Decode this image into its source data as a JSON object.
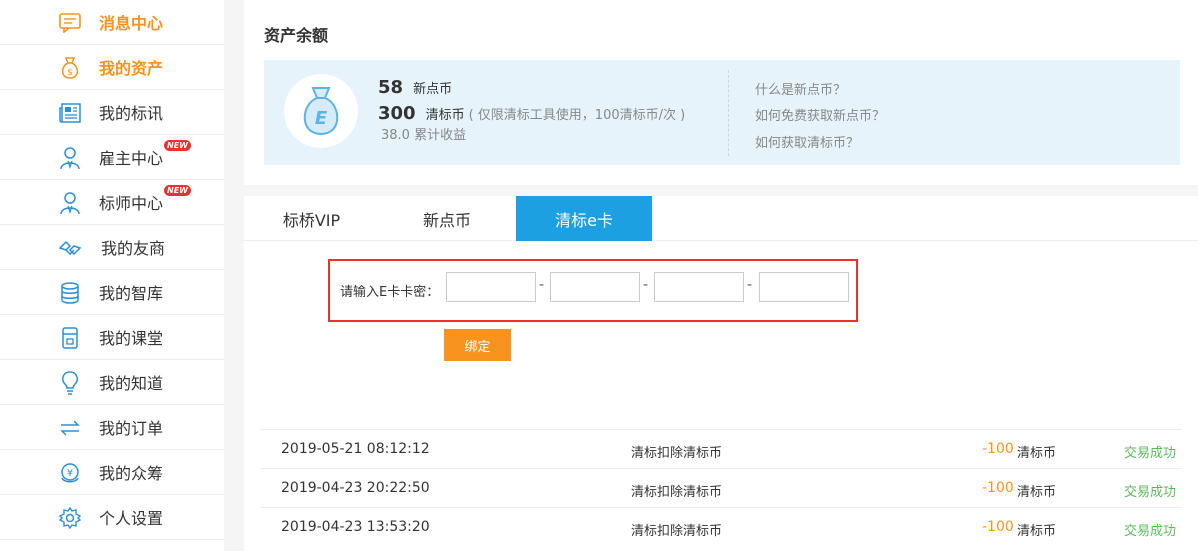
{
  "sidebar": {
    "items": [
      {
        "label": "消息中心",
        "icon": "message-icon",
        "active": true
      },
      {
        "label": "我的资产",
        "icon": "money-bag-icon",
        "active": true
      },
      {
        "label": "我的标讯",
        "icon": "newspaper-icon"
      },
      {
        "label": "雇主中心",
        "icon": "user-icon",
        "badge": "NEW"
      },
      {
        "label": "标师中心",
        "icon": "user-icon",
        "badge": "NEW"
      },
      {
        "label": "我的友商",
        "icon": "partners-icon"
      },
      {
        "label": "我的智库",
        "icon": "database-icon"
      },
      {
        "label": "我的课堂",
        "icon": "classroom-icon"
      },
      {
        "label": "我的知道",
        "icon": "lightbulb-icon"
      },
      {
        "label": "我的订单",
        "icon": "exchange-arrows-icon"
      },
      {
        "label": "我的众筹",
        "icon": "crowdfunding-icon"
      },
      {
        "label": "个人设置",
        "icon": "gear-icon"
      }
    ]
  },
  "asset": {
    "title": "资产余额",
    "new_coin_amount": "58",
    "new_coin_unit": "新点币",
    "qb_coin_amount": "300",
    "qb_coin_unit": "清标币",
    "qb_coin_note": "( 仅限清标工具使用，100清标币/次 )",
    "earnings": "38.0 累计收益",
    "faq": [
      "什么是新点币？",
      "如何免费获取新点币？",
      "如何获取清标币？"
    ]
  },
  "tabs": [
    "标桥VIP",
    "新点币",
    "清标e卡"
  ],
  "ecard": {
    "label": "请输入E卡卡密：",
    "separator": "-",
    "bind_button": "绑定"
  },
  "records": [
    {
      "time": "2019-05-21 08:12:12",
      "desc": "清标扣除清标币",
      "amount": "-100",
      "unit": "清标币",
      "status": "交易成功"
    },
    {
      "time": "2019-04-23 20:22:50",
      "desc": "清标扣除清标币",
      "amount": "-100",
      "unit": "清标币",
      "status": "交易成功"
    },
    {
      "time": "2019-04-23 13:53:20",
      "desc": "清标扣除清标币",
      "amount": "-100",
      "unit": "清标币",
      "status": "交易成功"
    }
  ],
  "colors": {
    "accent": "#f7931e",
    "primary": "#1da0e1",
    "icon": "#2b8fd6",
    "success": "#5cb85c",
    "highlight_border": "#e8332c"
  }
}
